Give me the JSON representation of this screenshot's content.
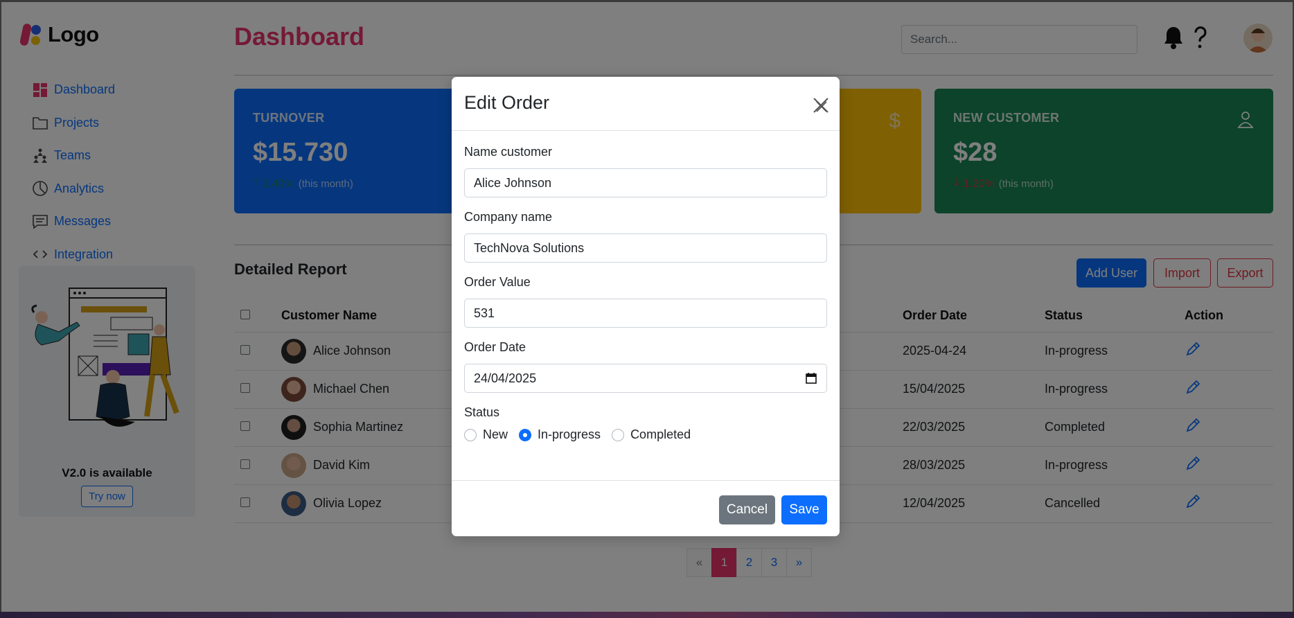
{
  "sidebar": {
    "logo_text": "Logo",
    "nav": [
      {
        "label": "Dashboard",
        "icon": "dashboard-grid-icon"
      },
      {
        "label": "Projects",
        "icon": "folder-icon"
      },
      {
        "label": "Teams",
        "icon": "teams-icon"
      },
      {
        "label": "Analytics",
        "icon": "pie-chart-icon"
      },
      {
        "label": "Messages",
        "icon": "message-icon"
      },
      {
        "label": "Integration",
        "icon": "code-icon"
      }
    ],
    "promo": {
      "title": "V2.0 is available",
      "button": "Try now"
    }
  },
  "header": {
    "title": "Dashboard",
    "search_placeholder": "Search...",
    "icons": [
      "bell-icon",
      "question-icon"
    ]
  },
  "cards": [
    {
      "label": "TURNOVER",
      "value": "$15.730",
      "change": "2.40%",
      "period": "(this month)",
      "color": "#0d6efd",
      "trend": "up"
    },
    {
      "label": "NEW CUSTOMER",
      "value": "$28",
      "change": "1.20%",
      "period": "(this month)",
      "color": "#198754",
      "trend": "down"
    }
  ],
  "yellow_card": {
    "icon": "$",
    "color": "#ffc107"
  },
  "report": {
    "title": "Detailed Report",
    "buttons": {
      "add_user": "Add User",
      "import": "Import",
      "export": "Export"
    },
    "columns": [
      "Customer Name",
      "Order Date",
      "Status",
      "Action"
    ],
    "rows": [
      {
        "name": "Alice Johnson",
        "date": "2025-04-24",
        "status": "In-progress",
        "status_color": "#0d6efd"
      },
      {
        "name": "Michael Chen",
        "date": "15/04/2025",
        "status": "In-progress",
        "status_color": "#0d6efd"
      },
      {
        "name": "Sophia Martinez",
        "date": "22/03/2025",
        "status": "Completed",
        "status_color": "#198754"
      },
      {
        "name": "David Kim",
        "date": "28/03/2025",
        "status": "In-progress",
        "status_color": "#0d6efd"
      },
      {
        "name": "Olivia Lopez",
        "date": "12/04/2025",
        "status": "Cancelled",
        "status_color": "#0dcaf0"
      }
    ]
  },
  "pagination": {
    "prev": "«",
    "pages": [
      "1",
      "2",
      "3"
    ],
    "next": "»",
    "active": "1"
  },
  "modal": {
    "title": "Edit Order",
    "fields": {
      "name_label": "Name customer",
      "name_value": "Alice Johnson",
      "company_label": "Company name",
      "company_value": "TechNova Solutions",
      "value_label": "Order Value",
      "value_value": "531",
      "date_label": "Order Date",
      "date_value": "24/04/2025",
      "status_label": "Status"
    },
    "status_options": [
      "New",
      "In-progress",
      "Completed"
    ],
    "selected_status": "In-progress",
    "cancel": "Cancel",
    "save": "Save"
  }
}
